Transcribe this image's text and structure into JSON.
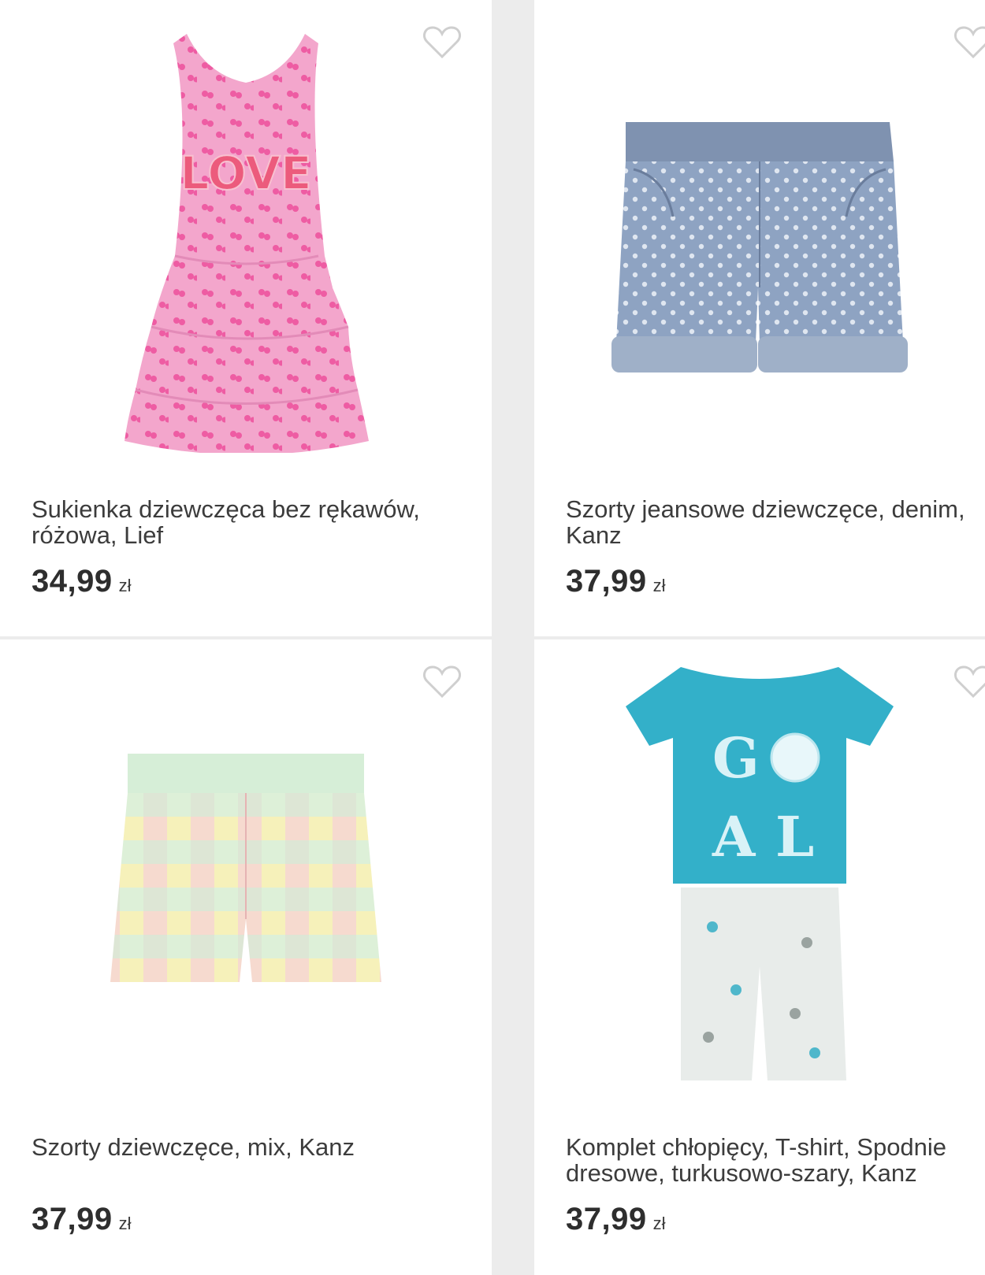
{
  "products": [
    {
      "title": "Sukienka dziewczęca bez rękawów, różowa, Lief",
      "price": "34,99",
      "currency": "zł",
      "image_icon": "pink-dress-image"
    },
    {
      "title": "Szorty jeansowe dziewczęce, denim, Kanz",
      "price": "37,99",
      "currency": "zł",
      "image_icon": "denim-shorts-image"
    },
    {
      "title": "Szorty dziewczęce, mix, Kanz",
      "price": "37,99",
      "currency": "zł",
      "image_icon": "plaid-shorts-image"
    },
    {
      "title": "Komplet chłopięcy, T-shirt, Spodnie dresowe, turkusowo-szary, Kanz",
      "price": "37,99",
      "currency": "zł",
      "image_icon": "tshirt-set-image"
    }
  ],
  "icons": {
    "favorite": "heart-outline-icon"
  },
  "colors": {
    "background": "#ececec",
    "card": "#ffffff",
    "text": "#3c3c3c",
    "price": "#2e2e2e",
    "heart_outline": "#cfcfcf"
  }
}
